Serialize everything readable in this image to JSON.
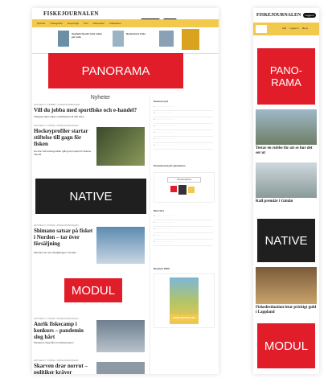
{
  "desktop": {
    "logo": "FISKEJOURNALEN",
    "top_buttons": [
      "Prenumerera",
      "Logga in"
    ],
    "menu_items": [
      "Nyheter",
      "Fiskeguider",
      "Reportage",
      "Test",
      "Reseväner",
      "Fiskekartor"
    ],
    "menu_headline_1": "Upptäck läsvärt hela sidan per sida",
    "menu_headline_2": "Nyhetsbrev fiske",
    "panorama_label": "PANORAMA",
    "section_title": "Nyheter",
    "articles": [
      {
        "kicker": "AKTUELLT / HOBBY / FISKEJOURNALEN",
        "title": "Vill du jobba med sportfiske och e-handel?",
        "teaser": "Fiskejournalen söker medarbetare till vårt team."
      },
      {
        "kicker": "AKTUELLT / FISKE / FISKEJOURNALEN",
        "title": "Hockeyprofiler startar stiftelse till gagn för fisken",
        "teaser": "Nu drar två hockeyprofiler igång ett projekt för fiskens framtid."
      },
      {
        "kicker": "AKTUELLT / FISKE / FISKEJOURNALEN",
        "title": "Shimano satsar på fisket i Norden – tar över försäljning",
        "teaser": "Shimano tar över försäljningen i Norden."
      },
      {
        "kicker": "AKTUELLT / FISKE / FISKEJOURNALEN",
        "title": "Anrik fiskecamp i konkurs – pandemin slog hårt",
        "teaser": "Pandemin slog hårt mot fiskecampen."
      },
      {
        "kicker": "AKTUELLT / FISKE / FISKEJOURNALEN",
        "title": "Skarven drar norrut – politiker kräver",
        "teaser": ""
      }
    ],
    "native_label": "NATIVE",
    "modul_label": "MODUL",
    "sidebar_title_1": "Senaste nytt",
    "sidebar_title_2": "Prenumerera på nyhetsbrev",
    "sidebar_title_3": "Mest läst",
    "sidebar_title_4": "Nummer 2020",
    "newsletter_button": "Prenumerera",
    "magazine_label": "FISKEJOURNALEN"
  },
  "mobile": {
    "logo": "FISKEJOURNALEN",
    "login_button": "Logga in",
    "nav_items": [
      "Sök",
      "Logga in",
      "Meny"
    ],
    "panorama_label": "PANO-\nRAMA",
    "native_label": "NATIVE",
    "modul_label": "MODUL",
    "articles": [
      {
        "title": "Testar en rubbe för att se hur det ser ut"
      },
      {
        "title": "Kall premiär i Gimån"
      },
      {
        "title": "Fiskedestination letar prickigt guld i Lappland"
      }
    ]
  },
  "colors": {
    "brand_yellow": "#f2c94c",
    "ad_red": "#e11d2a",
    "ad_dark": "#1f1f1f"
  }
}
